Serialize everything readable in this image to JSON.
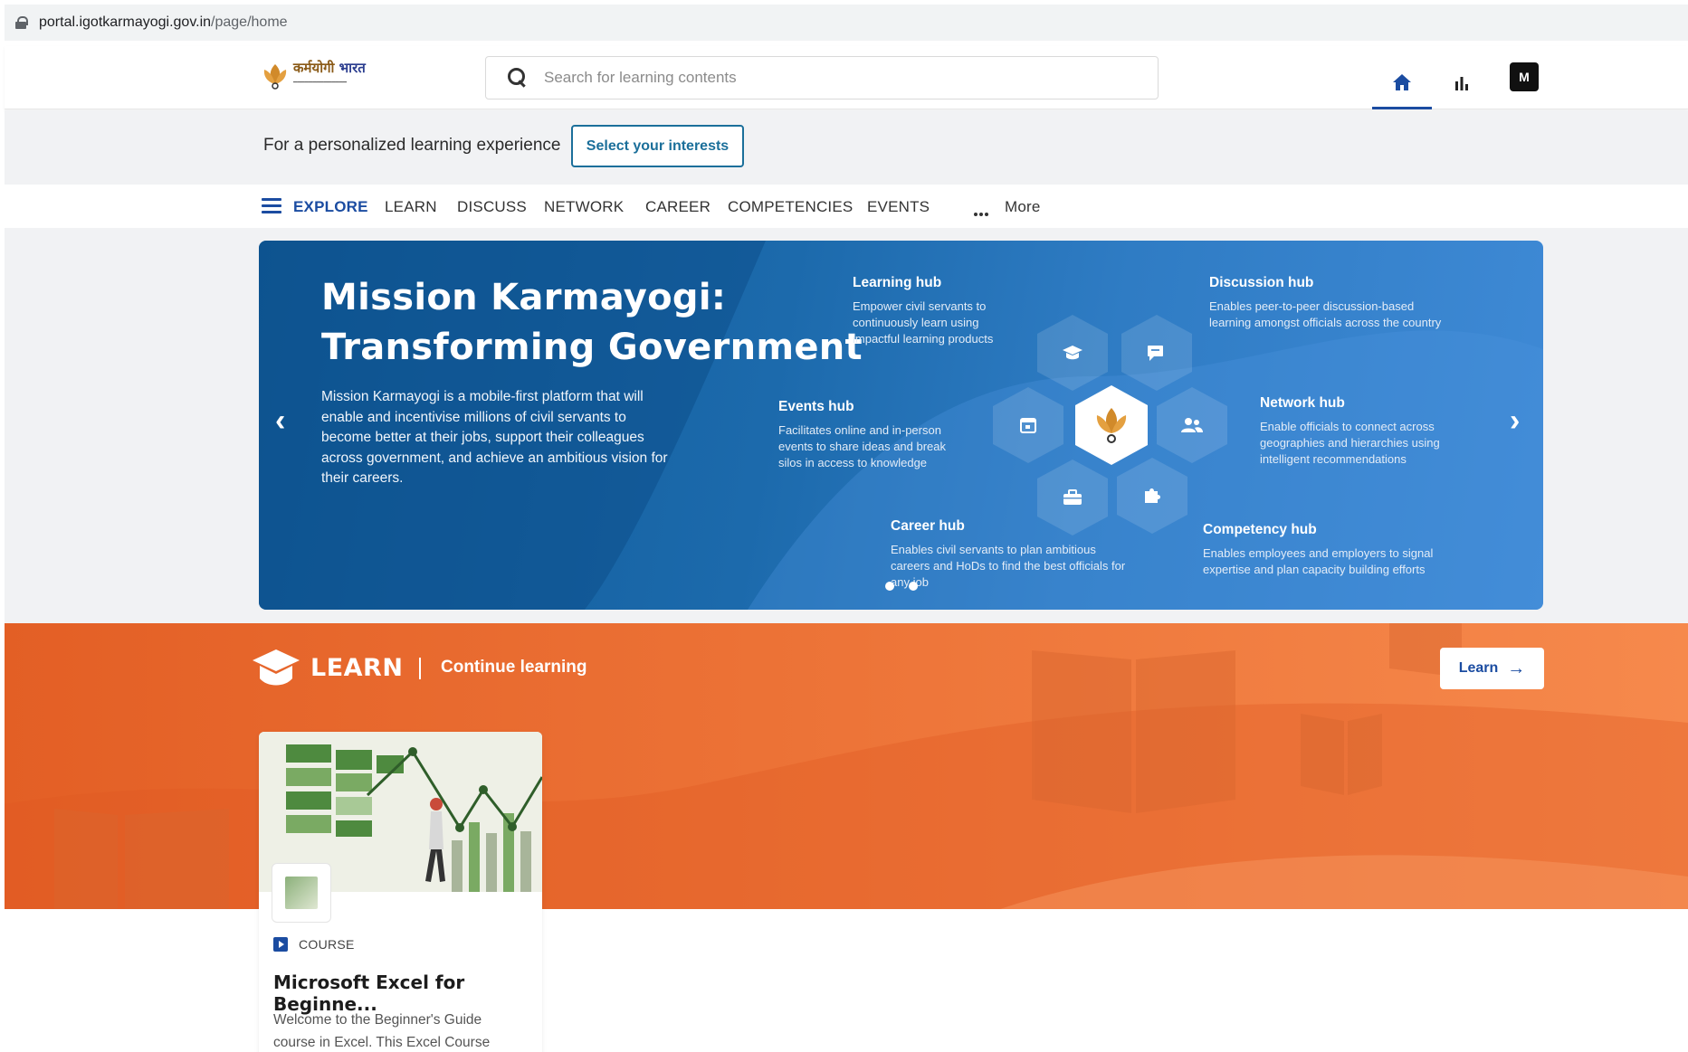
{
  "browser": {
    "url_host": "portal.igotkarmayogi.gov.in",
    "url_path": "/page/home"
  },
  "header": {
    "logo_text": "कर्मयोगी",
    "logo_text_b": "भारत",
    "search_placeholder": "Search for learning contents",
    "avatar_initial": "M"
  },
  "interest_bar": {
    "label": "For a personalized learning experience",
    "button": "Select your interests"
  },
  "nav": {
    "items": [
      "EXPLORE",
      "LEARN",
      "DISCUSS",
      "NETWORK",
      "CAREER",
      "COMPETENCIES",
      "EVENTS"
    ],
    "more": "More"
  },
  "banner": {
    "title_line1": "Mission Karmayogi:",
    "title_line2": "Transforming Government",
    "description": "Mission Karmayogi is a mobile-first platform that will enable and incentivise millions of civil servants to become better at their jobs, support their colleagues across government, and achieve an ambitious vision for their careers.",
    "prev_arrow": "‹",
    "next_arrow": "›",
    "hubs": {
      "learning": {
        "title": "Learning hub",
        "desc": "Empower civil servants to continuously learn using impactful learning products"
      },
      "discussion": {
        "title": "Discussion hub",
        "desc": "Enables peer-to-peer discussion-based learning amongst officials across the country"
      },
      "events": {
        "title": "Events hub",
        "desc": "Facilitates online and in-person events to share ideas and break silos in access to knowledge"
      },
      "network": {
        "title": "Network hub",
        "desc": "Enable officials to connect across geographies and hierarchies using intelligent recommendations"
      },
      "career": {
        "title": "Career hub",
        "desc": "Enables civil servants to plan ambitious careers and HoDs to find the best officials for any job"
      },
      "competency": {
        "title": "Competency hub",
        "desc": "Enables employees and employers to signal expertise and plan capacity building efforts"
      }
    },
    "slides_count": 2,
    "active_slide": 1
  },
  "learn_section": {
    "title": "LEARN",
    "subtitle": "Continue learning",
    "button": "Learn",
    "card": {
      "type": "COURSE",
      "name": "Microsoft Excel for Beginne...",
      "description": "Welcome to the Beginner's Guide course in Excel. This Excel Course"
    }
  },
  "colors": {
    "brand_blue": "#1b4ca1",
    "banner_blue": "#1c6aac",
    "learn_orange": "#ec7236"
  }
}
